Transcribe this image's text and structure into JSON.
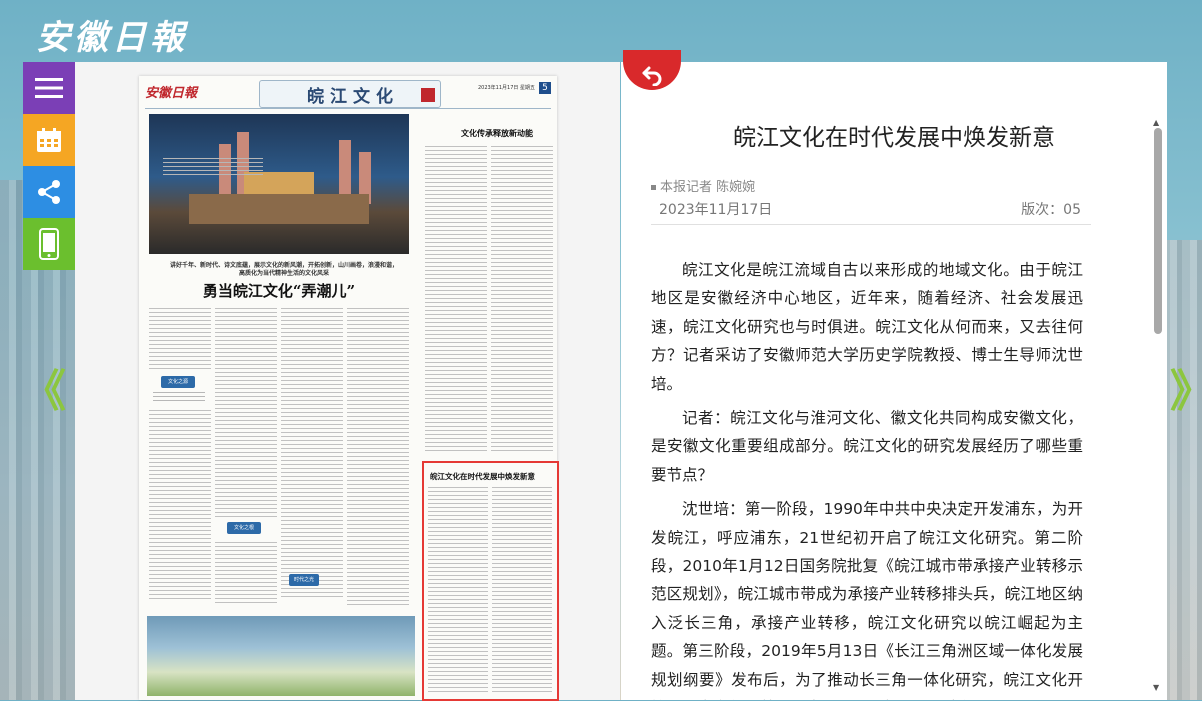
{
  "site": {
    "logo_text": "安徽日報"
  },
  "side_menu": {
    "icons": [
      "menu-icon",
      "calendar-icon",
      "share-icon",
      "mobile-icon"
    ]
  },
  "navigation": {
    "prev": "《",
    "next": "》"
  },
  "newspaper_page": {
    "masthead": "安徽日報",
    "section_title": [
      "皖",
      "江",
      "文",
      "化"
    ],
    "date_line": "2023年11月17日 星期五",
    "page_number": "5",
    "main_headline_sub": "讲好千年、新时代、诗文底蕴，展示文化的新风潮，开拓创新，山川画卷，浪漫和谐，高质化为当代精神生活的文化风采",
    "main_headline": "勇当皖江文化“弄潮儿”",
    "right_column_title": "文化传承释放新动能",
    "highlighted_article_title": "皖江文化在时代发展中焕发新意",
    "tags": [
      "文化之源",
      "文化之根",
      "时代之光"
    ]
  },
  "article": {
    "title": "皖江文化在时代发展中焕发新意",
    "byline": "本报记者 陈婉婉",
    "date": "2023年11月17日",
    "edition": "版次：05",
    "paragraphs": [
      "皖江文化是皖江流域自古以来形成的地域文化。由于皖江地区是安徽经济中心地区，近年来，随着经济、社会发展迅速，皖江文化研究也与时俱进。皖江文化从何而来，又去往何方？记者采访了安徽师范大学历史学院教授、博士生导师沈世培。",
      "记者：皖江文化与淮河文化、徽文化共同构成安徽文化，是安徽文化重要组成部分。皖江文化的研究发展经历了哪些重要节点？",
      "沈世培：第一阶段，1990年中共中央决定开发浦东，为开发皖江，呼应浦东，21世纪初开启了皖江文化研究。第二阶段，2010年1月12日国务院批复《皖江城市带承接产业转移示范区规划》，皖江城市带成为承接产业转移排头兵，皖江地区纳入泛长三角，承接产业转移，皖江文化研究以皖江崛起为主题。第三阶段，2019年5月13日《长江三角洲区域一体化发展规划纲要》发布后，为了推动长三角一体化研究，皖江文化开始与江南文化“对接”研究，进一步拓展了研究视野。"
    ]
  },
  "colors": {
    "accent_red": "#d9292b",
    "highlight_border": "#e53935",
    "arrow_green": "#8cc63f"
  }
}
